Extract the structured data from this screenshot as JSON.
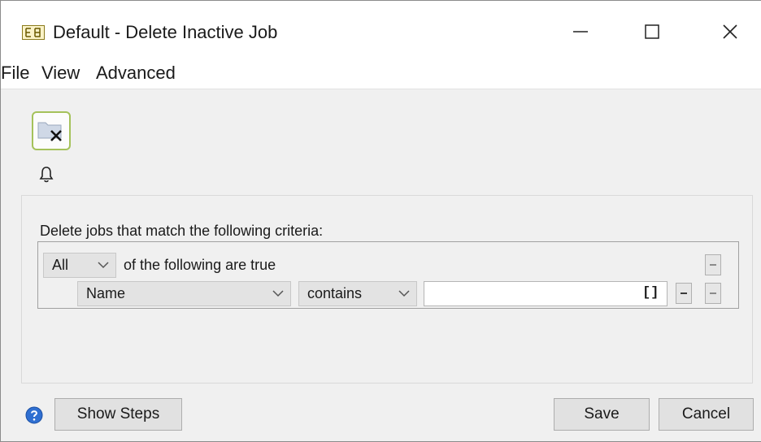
{
  "window": {
    "title": "Default - Delete Inactive Job"
  },
  "menu": {
    "items": [
      "File",
      "View",
      "Advanced"
    ]
  },
  "criteria": {
    "heading": "Delete jobs that match the following criteria:",
    "match_mode": "All",
    "match_suffix": "of the following are true",
    "rule": {
      "field": "Name",
      "operator": "contains",
      "value": "",
      "value_indicator": "[]"
    }
  },
  "footer": {
    "show_steps": "Show Steps",
    "save": "Save",
    "cancel": "Cancel"
  },
  "icons": [
    "app-icon",
    "delete-job-icon",
    "bell-icon",
    "help-icon",
    "chevron-down-icon",
    "minus-icon"
  ],
  "colors": {
    "accent_border": "#a5c25b",
    "help_blue": "#2f6fd1",
    "panel_bg": "#f0f0f0"
  }
}
